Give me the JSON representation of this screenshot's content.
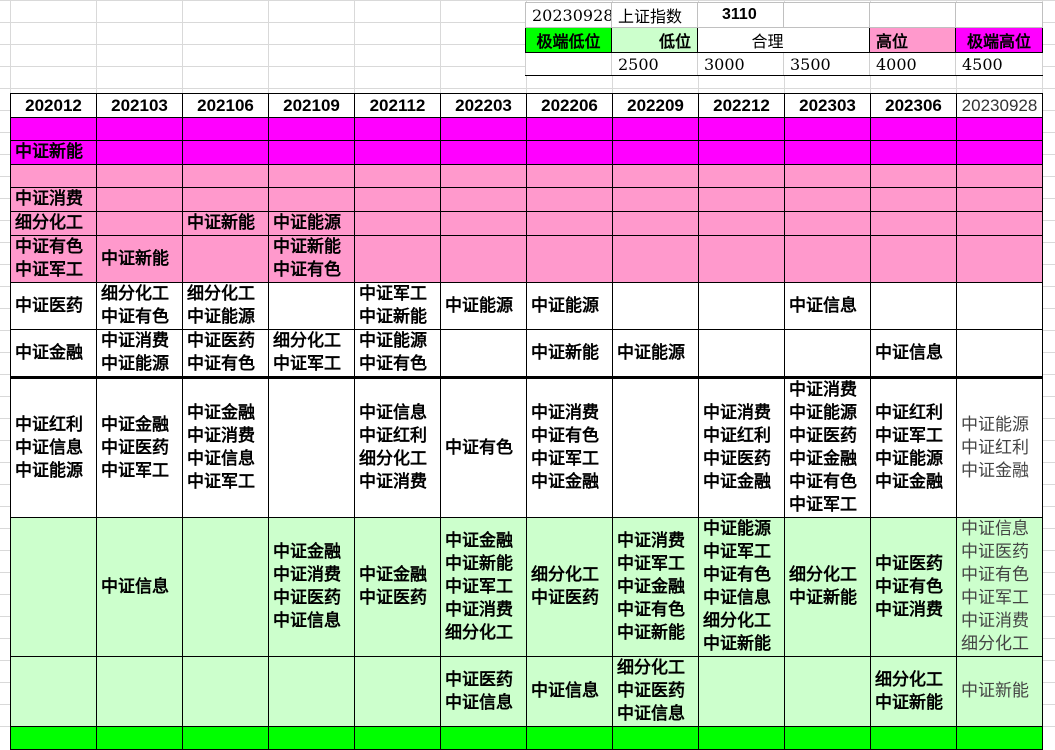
{
  "header": {
    "date": "20230928",
    "index_label": "上证指数",
    "index_value": "3110"
  },
  "zones": [
    {
      "label": "极端低位",
      "threshold": "",
      "color": "#00ff00"
    },
    {
      "label": "低位",
      "threshold": "2500",
      "color": "#ccffcc"
    },
    {
      "label": "合理",
      "threshold": "3000",
      "color": "#ffffff"
    },
    {
      "label": "",
      "threshold": "3500",
      "color": "#ffffff"
    },
    {
      "label": "高位",
      "threshold": "4000",
      "color": "#ff99cc"
    },
    {
      "label": "极端高位",
      "threshold": "4500",
      "color": "#ff00ff"
    }
  ],
  "columns": [
    "202012",
    "202103",
    "202106",
    "202109",
    "202112",
    "202203",
    "202206",
    "202209",
    "202212",
    "202303",
    "202306",
    "20230928"
  ],
  "rows": [
    {
      "color": "#ff00ff",
      "cells": [
        [],
        [],
        [],
        [],
        [],
        [],
        [],
        [],
        [],
        [],
        [],
        []
      ]
    },
    {
      "color": "#ff00ff",
      "cells": [
        [
          "中证新能"
        ],
        [],
        [],
        [],
        [],
        [],
        [],
        [],
        [],
        [],
        [],
        []
      ]
    },
    {
      "color": "#ff99cc",
      "cells": [
        [],
        [],
        [],
        [],
        [],
        [],
        [],
        [],
        [],
        [],
        [],
        []
      ]
    },
    {
      "color": "#ff99cc",
      "cells": [
        [
          "中证消费"
        ],
        [],
        [],
        [],
        [],
        [],
        [],
        [],
        [],
        [],
        [],
        []
      ]
    },
    {
      "color": "#ff99cc",
      "cells": [
        [
          "细分化工"
        ],
        [],
        [
          "中证新能"
        ],
        [
          "中证能源"
        ],
        [],
        [],
        [],
        [],
        [],
        [],
        [],
        []
      ]
    },
    {
      "color": "#ff99cc",
      "cells": [
        [
          "中证有色",
          "中证军工"
        ],
        [
          "中证新能"
        ],
        [],
        [
          "中证新能",
          "中证有色"
        ],
        [],
        [],
        [],
        [],
        [],
        [],
        [],
        []
      ]
    },
    {
      "color": "#ffffff",
      "cells": [
        [
          "中证医药"
        ],
        [
          "细分化工",
          "中证有色"
        ],
        [
          "细分化工",
          "中证能源"
        ],
        [],
        [
          "中证军工",
          "中证新能"
        ],
        [
          "中证能源"
        ],
        [
          "中证能源"
        ],
        [],
        [],
        [
          "中证信息"
        ],
        [],
        []
      ]
    },
    {
      "color": "#ffffff",
      "cells": [
        [
          "中证金融"
        ],
        [
          "中证消费",
          "中证能源"
        ],
        [
          "中证医药",
          "中证有色"
        ],
        [
          "细分化工",
          "中证军工"
        ],
        [
          "中证能源",
          "中证有色"
        ],
        [],
        [
          "中证新能"
        ],
        [
          "中证能源"
        ],
        [],
        [],
        [
          "中证信息"
        ],
        []
      ]
    },
    {
      "color": "#ffffff",
      "cells": [
        [
          "中证红利",
          "中证信息",
          "中证能源"
        ],
        [
          "中证金融",
          "中证医药",
          "中证军工"
        ],
        [
          "中证金融",
          "中证消费",
          "中证信息",
          "中证军工"
        ],
        [],
        [
          "中证信息",
          "中证红利",
          "细分化工",
          "中证消费"
        ],
        [
          "中证有色"
        ],
        [
          "中证消费",
          "中证有色",
          "中证军工",
          "中证金融"
        ],
        [],
        [
          "中证消费",
          "中证红利",
          "中证医药",
          "中证金融"
        ],
        [
          "中证消费",
          "中证能源",
          "中证医药",
          "中证金融",
          "中证有色",
          "中证军工"
        ],
        [
          "中证红利",
          "中证军工",
          "中证能源",
          "中证金融"
        ],
        [
          "中证能源",
          "中证红利",
          "中证金融"
        ]
      ]
    },
    {
      "color": "#ccffcc",
      "cells": [
        [],
        [
          "中证信息"
        ],
        [],
        [
          "中证金融",
          "中证消费",
          "中证医药",
          "中证信息"
        ],
        [
          "中证金融",
          "中证医药"
        ],
        [
          "中证金融",
          "中证新能",
          "中证军工",
          "中证消费",
          "细分化工"
        ],
        [
          "细分化工",
          "中证医药"
        ],
        [
          "中证消费",
          "中证军工",
          "中证金融",
          "中证有色",
          "中证新能"
        ],
        [
          "中证能源",
          "中证军工",
          "中证有色",
          "中证信息",
          "细分化工",
          "中证新能"
        ],
        [
          "细分化工",
          "中证新能"
        ],
        [
          "中证医药",
          "中证有色",
          "中证消费"
        ],
        [
          "中证信息",
          "中证医药",
          "中证有色",
          "中证军工",
          "中证消费",
          "细分化工"
        ]
      ]
    },
    {
      "color": "#ccffcc",
      "cells": [
        [],
        [],
        [],
        [],
        [],
        [
          "中证医药",
          "中证信息"
        ],
        [
          "中证信息"
        ],
        [
          "细分化工",
          "中证医药",
          "中证信息"
        ],
        [],
        [],
        [
          "细分化工",
          "中证新能"
        ],
        [
          "中证新能"
        ]
      ]
    },
    {
      "color": "#00ff00",
      "cells": [
        [],
        [],
        [],
        [],
        [],
        [],
        [],
        [],
        [],
        [],
        [],
        []
      ]
    }
  ]
}
